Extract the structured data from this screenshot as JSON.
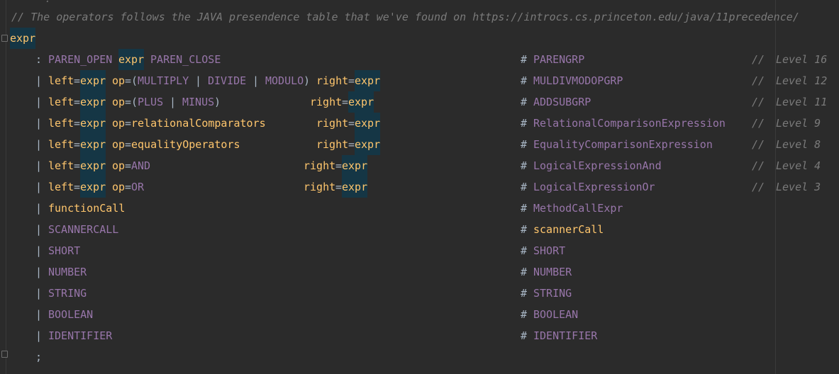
{
  "header_comment": "// The operators follows the JAVA presendence table that we've found on https://introcs.cs.princeton.edu/java/11precedence/",
  "rule_name": "expr",
  "alternatives": [
    {
      "parts": [
        [
          ": ",
          "pun"
        ],
        [
          "PAREN_OPEN ",
          "tok"
        ],
        [
          "expr",
          "rule"
        ],
        [
          " PAREN_CLOSE",
          "tok"
        ]
      ],
      "label": "PARENGRP",
      "level": "Level 16"
    },
    {
      "parts": [
        [
          "| ",
          "pun"
        ],
        [
          "left",
          "rule"
        ],
        [
          "=",
          "pun"
        ],
        [
          "expr",
          "rule"
        ],
        [
          " op",
          "rule"
        ],
        [
          "=(",
          "pun"
        ],
        [
          "MULTIPLY",
          "tok"
        ],
        [
          " | ",
          "pun"
        ],
        [
          "DIVIDE",
          "tok"
        ],
        [
          " | ",
          "pun"
        ],
        [
          "MODULO",
          "tok"
        ],
        [
          ") ",
          "pun"
        ],
        [
          "right",
          "rule"
        ],
        [
          "=",
          "pun"
        ],
        [
          "expr",
          "rule"
        ]
      ],
      "label": "MULDIVMODOPGRP",
      "level": "Level 12"
    },
    {
      "parts": [
        [
          "| ",
          "pun"
        ],
        [
          "left",
          "rule"
        ],
        [
          "=",
          "pun"
        ],
        [
          "expr",
          "rule"
        ],
        [
          " op",
          "rule"
        ],
        [
          "=(",
          "pun"
        ],
        [
          "PLUS",
          "tok"
        ],
        [
          " | ",
          "pun"
        ],
        [
          "MINUS",
          "tok"
        ],
        [
          ")",
          "pun"
        ],
        [
          "              ",
          "pun"
        ],
        [
          "right",
          "rule"
        ],
        [
          "=",
          "pun"
        ],
        [
          "expr",
          "rule"
        ]
      ],
      "label": "ADDSUBGRP",
      "level": "Level 11"
    },
    {
      "parts": [
        [
          "| ",
          "pun"
        ],
        [
          "left",
          "rule"
        ],
        [
          "=",
          "pun"
        ],
        [
          "expr",
          "rule"
        ],
        [
          " op",
          "rule"
        ],
        [
          "=",
          "pun"
        ],
        [
          "relationalComparators",
          "rule"
        ],
        [
          "        ",
          "pun"
        ],
        [
          "right",
          "rule"
        ],
        [
          "=",
          "pun"
        ],
        [
          "expr",
          "rule"
        ]
      ],
      "label": "RelationalComparisonExpression",
      "level": "Level 9"
    },
    {
      "parts": [
        [
          "| ",
          "pun"
        ],
        [
          "left",
          "rule"
        ],
        [
          "=",
          "pun"
        ],
        [
          "expr",
          "rule"
        ],
        [
          " op",
          "rule"
        ],
        [
          "=",
          "pun"
        ],
        [
          "equalityOperators",
          "rule"
        ],
        [
          "            ",
          "pun"
        ],
        [
          "right",
          "rule"
        ],
        [
          "=",
          "pun"
        ],
        [
          "expr",
          "rule"
        ]
      ],
      "label": "EqualityComparisonExpression",
      "level": "Level 8"
    },
    {
      "parts": [
        [
          "| ",
          "pun"
        ],
        [
          "left",
          "rule"
        ],
        [
          "=",
          "pun"
        ],
        [
          "expr",
          "rule"
        ],
        [
          " op",
          "rule"
        ],
        [
          "=",
          "pun"
        ],
        [
          "AND",
          "tok"
        ],
        [
          "                        ",
          "pun"
        ],
        [
          "right",
          "rule"
        ],
        [
          "=",
          "pun"
        ],
        [
          "expr",
          "rule"
        ]
      ],
      "label": "LogicalExpressionAnd",
      "level": "Level 4"
    },
    {
      "parts": [
        [
          "| ",
          "pun"
        ],
        [
          "left",
          "rule"
        ],
        [
          "=",
          "pun"
        ],
        [
          "expr",
          "rule"
        ],
        [
          " op",
          "rule"
        ],
        [
          "=",
          "pun"
        ],
        [
          "OR",
          "tok"
        ],
        [
          "                         ",
          "pun"
        ],
        [
          "right",
          "rule"
        ],
        [
          "=",
          "pun"
        ],
        [
          "expr",
          "rule"
        ]
      ],
      "label": "LogicalExpressionOr",
      "level": "Level 3"
    },
    {
      "parts": [
        [
          "| ",
          "pun"
        ],
        [
          "functionCall",
          "rule"
        ]
      ],
      "label": "MethodCallExpr",
      "level": ""
    },
    {
      "parts": [
        [
          "| ",
          "pun"
        ],
        [
          "SCANNERCALL",
          "tok"
        ]
      ],
      "label": "scannerCall",
      "level": ""
    },
    {
      "parts": [
        [
          "| ",
          "pun"
        ],
        [
          "SHORT",
          "tok"
        ]
      ],
      "label": "SHORT",
      "level": ""
    },
    {
      "parts": [
        [
          "| ",
          "pun"
        ],
        [
          "NUMBER",
          "tok"
        ]
      ],
      "label": "NUMBER",
      "level": ""
    },
    {
      "parts": [
        [
          "| ",
          "pun"
        ],
        [
          "STRING",
          "tok"
        ]
      ],
      "label": "STRING",
      "level": ""
    },
    {
      "parts": [
        [
          "| ",
          "pun"
        ],
        [
          "BOOLEAN",
          "tok"
        ]
      ],
      "label": "BOOLEAN",
      "level": ""
    },
    {
      "parts": [
        [
          "| ",
          "pun"
        ],
        [
          "IDENTIFIER",
          "tok"
        ]
      ],
      "label": "IDENTIFIER",
      "level": ""
    }
  ],
  "label_styles": {
    "scannerCall": "rule"
  },
  "hash": "#",
  "level_comment": "//",
  "terminator": ";",
  "colors": {
    "background": "#2b2b2b",
    "comment": "#7a7a7a",
    "token": "#9876aa",
    "rule": "#ffc66d",
    "punctuation": "#a9b7c6",
    "highlight": "#153645"
  }
}
